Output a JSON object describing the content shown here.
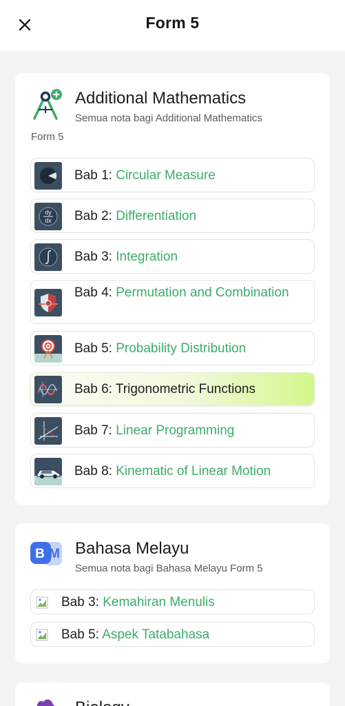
{
  "header": {
    "title": "Form 5",
    "close_icon": "close-icon"
  },
  "colors": {
    "accent": "#3cad6a",
    "highlight": "#d3f78a"
  },
  "subjects": [
    {
      "title": "Additional Mathematics",
      "desc_line1": "Semua nota bagi Additional Mathematics",
      "desc_line2": "Form 5",
      "icon": "compass-icon",
      "chapters": [
        {
          "prefix": "Bab 1: ",
          "name": "Circular Measure",
          "icon": "circular-measure-icon"
        },
        {
          "prefix": "Bab 2: ",
          "name": "Differentiation",
          "icon": "dy-dx-icon"
        },
        {
          "prefix": "Bab 3: ",
          "name": "Integration",
          "icon": "integral-icon"
        },
        {
          "prefix": "Bab 4: ",
          "name": "Permutation and Combination",
          "icon": "shield-icon"
        },
        {
          "prefix": "Bab 5: ",
          "name": "Probability Distribution",
          "icon": "target-icon"
        },
        {
          "prefix": "Bab 6: ",
          "name": "Trigonometric Functions",
          "icon": "sine-wave-icon",
          "selected": true
        },
        {
          "prefix": "Bab 7: ",
          "name": "Linear Programming",
          "icon": "graph-icon"
        },
        {
          "prefix": "Bab 8: ",
          "name": "Kinematic of Linear Motion",
          "icon": "car-icon"
        }
      ]
    },
    {
      "title": "Bahasa Melayu",
      "desc_line1": "Semua nota bagi Bahasa Melayu Form 5",
      "icon_text": "BM",
      "icon": "bm-icon",
      "chapters": [
        {
          "prefix": "Bab 3: ",
          "name": "Kemahiran Menulis",
          "icon": "broken-image-icon"
        },
        {
          "prefix": "Bab 5: ",
          "name": "Aspek Tatabahasa",
          "icon": "broken-image-icon"
        }
      ]
    },
    {
      "title": "Biology",
      "icon": "biology-icon"
    }
  ]
}
